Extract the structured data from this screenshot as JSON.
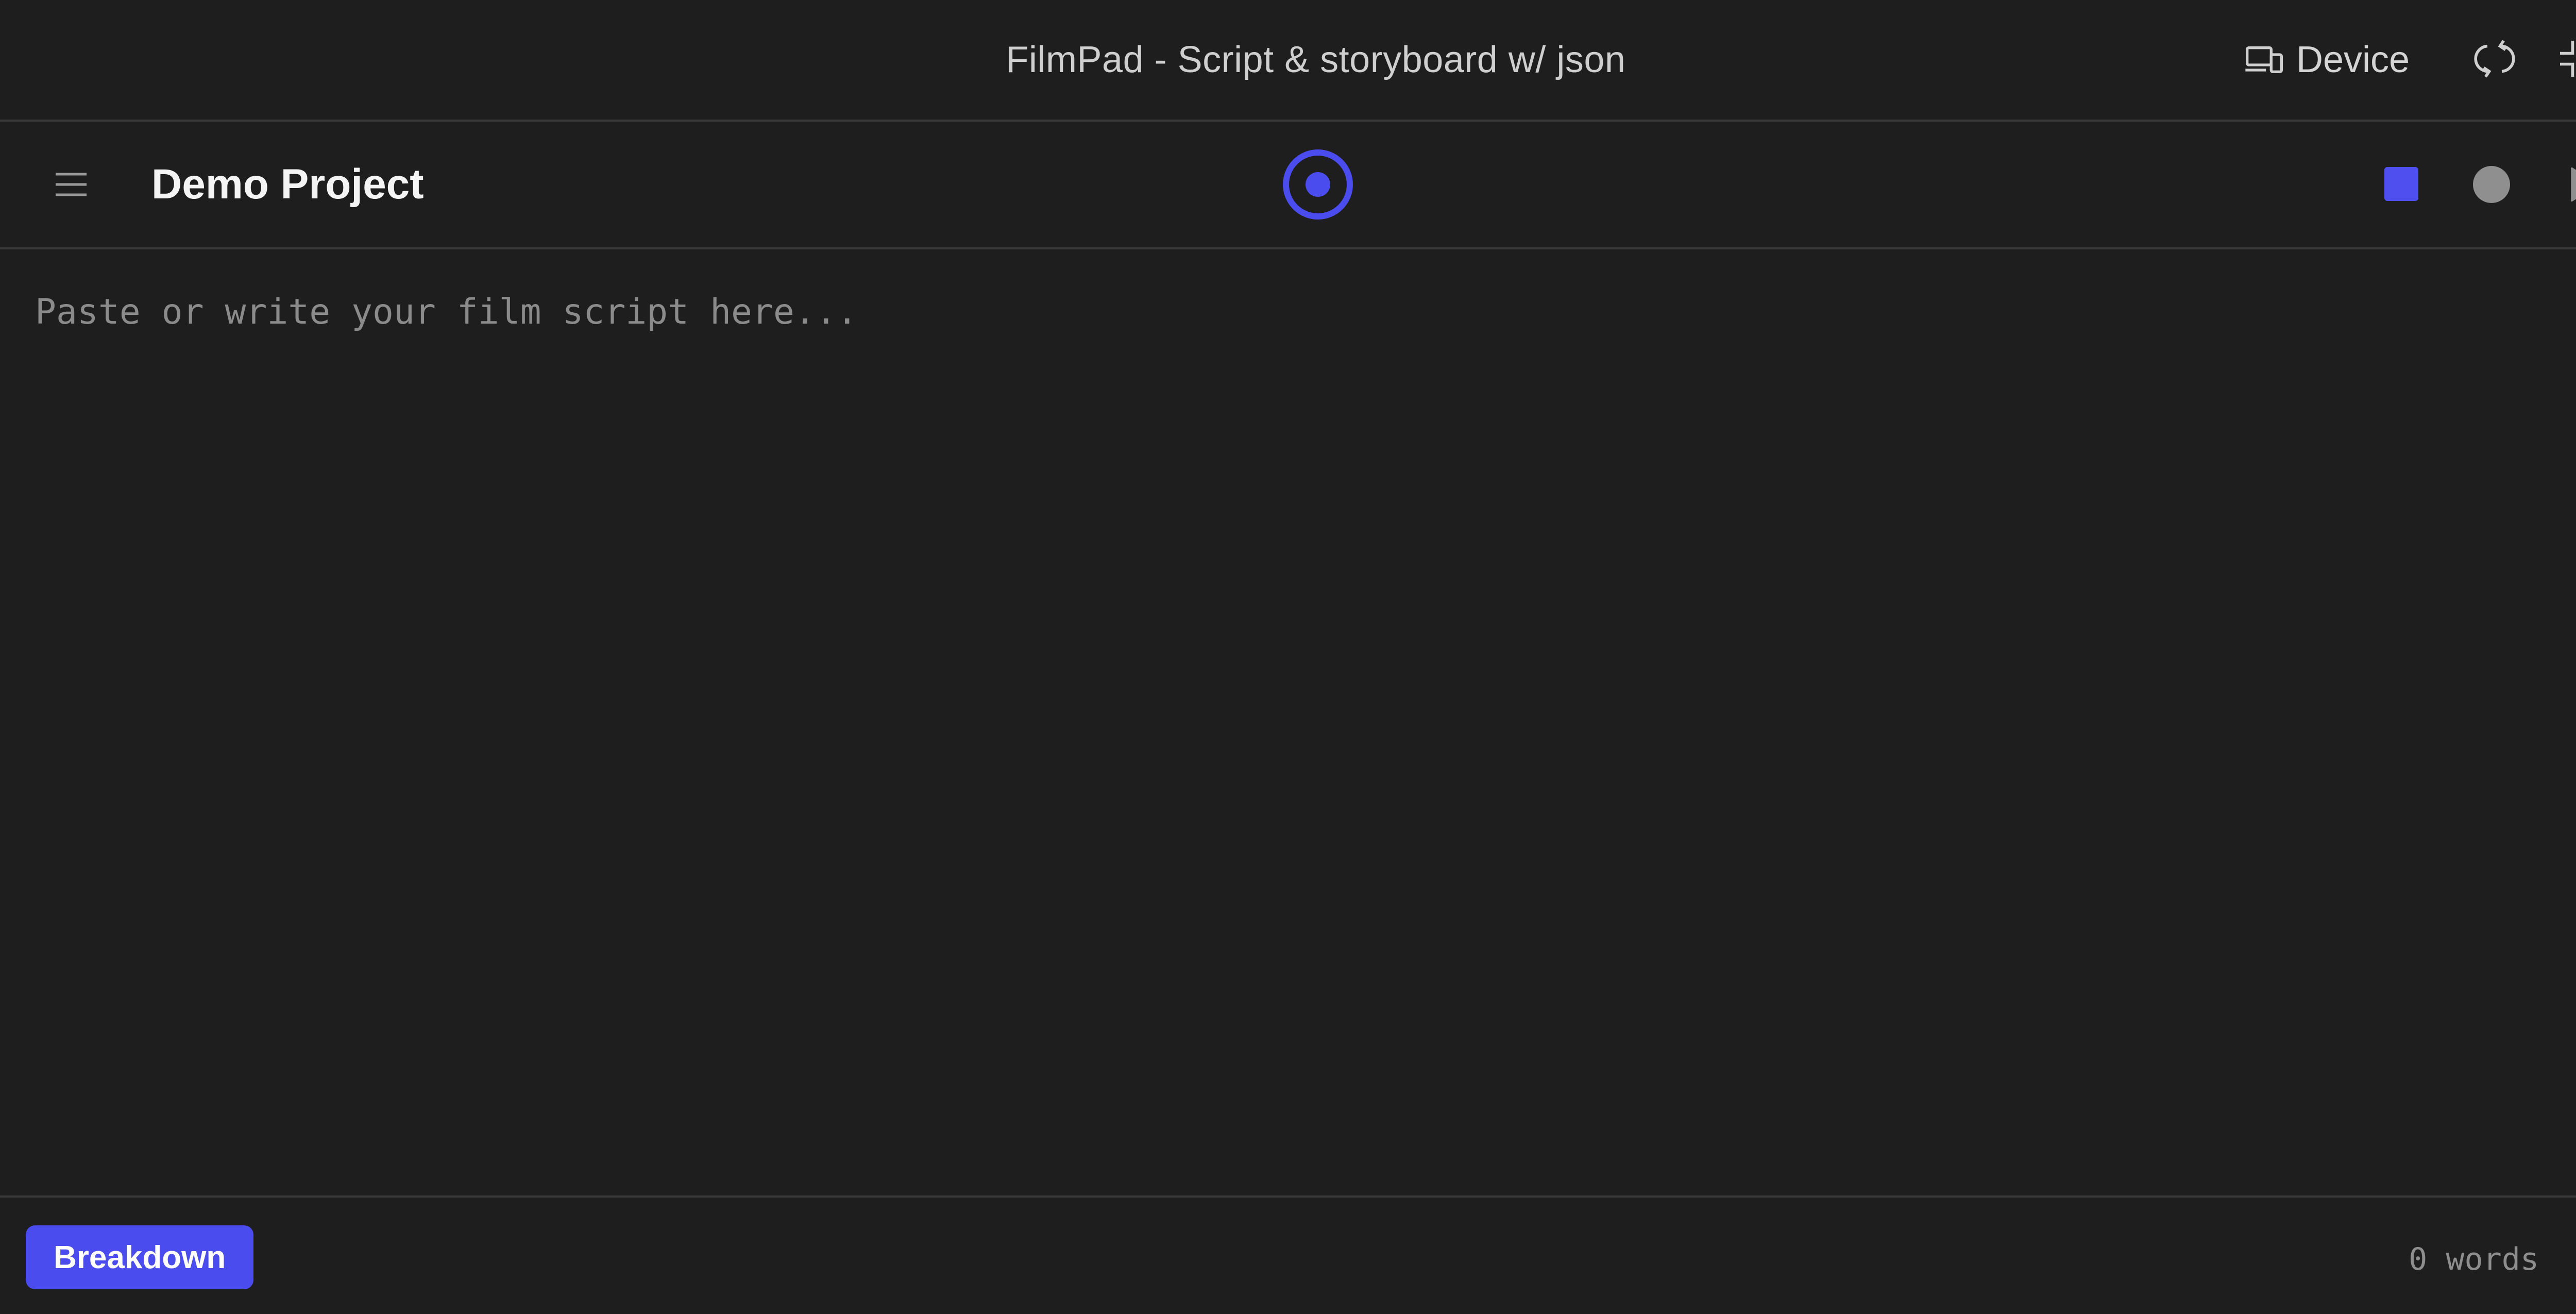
{
  "window": {
    "title": "FilmPad - Script & storyboard w/ json",
    "device_label": "Device",
    "device_icon": "device-icon",
    "rotate_icon": "rotate-icon",
    "fullscreen_icon": "exit-fullscreen-icon"
  },
  "header": {
    "menu_icon": "hamburger-menu-icon",
    "project_title": "Demo Project",
    "record_icon": "record-target-icon",
    "controls": [
      {
        "name": "stop-button",
        "icon": "square-icon",
        "color": "#4f4ff0"
      },
      {
        "name": "record-button",
        "icon": "circle-icon",
        "color": "#8f8f8f"
      },
      {
        "name": "play-button",
        "icon": "play-icon",
        "color": "#8f8f8f"
      }
    ]
  },
  "editor": {
    "placeholder": "Paste or write your film script here...",
    "value": ""
  },
  "footer": {
    "breakdown_label": "Breakdown",
    "word_count": "0 words",
    "clipboard_icon": "clipboard-icon"
  },
  "colors": {
    "accent": "#4b4ced",
    "background": "#1e1e1e",
    "divider": "#393939"
  }
}
